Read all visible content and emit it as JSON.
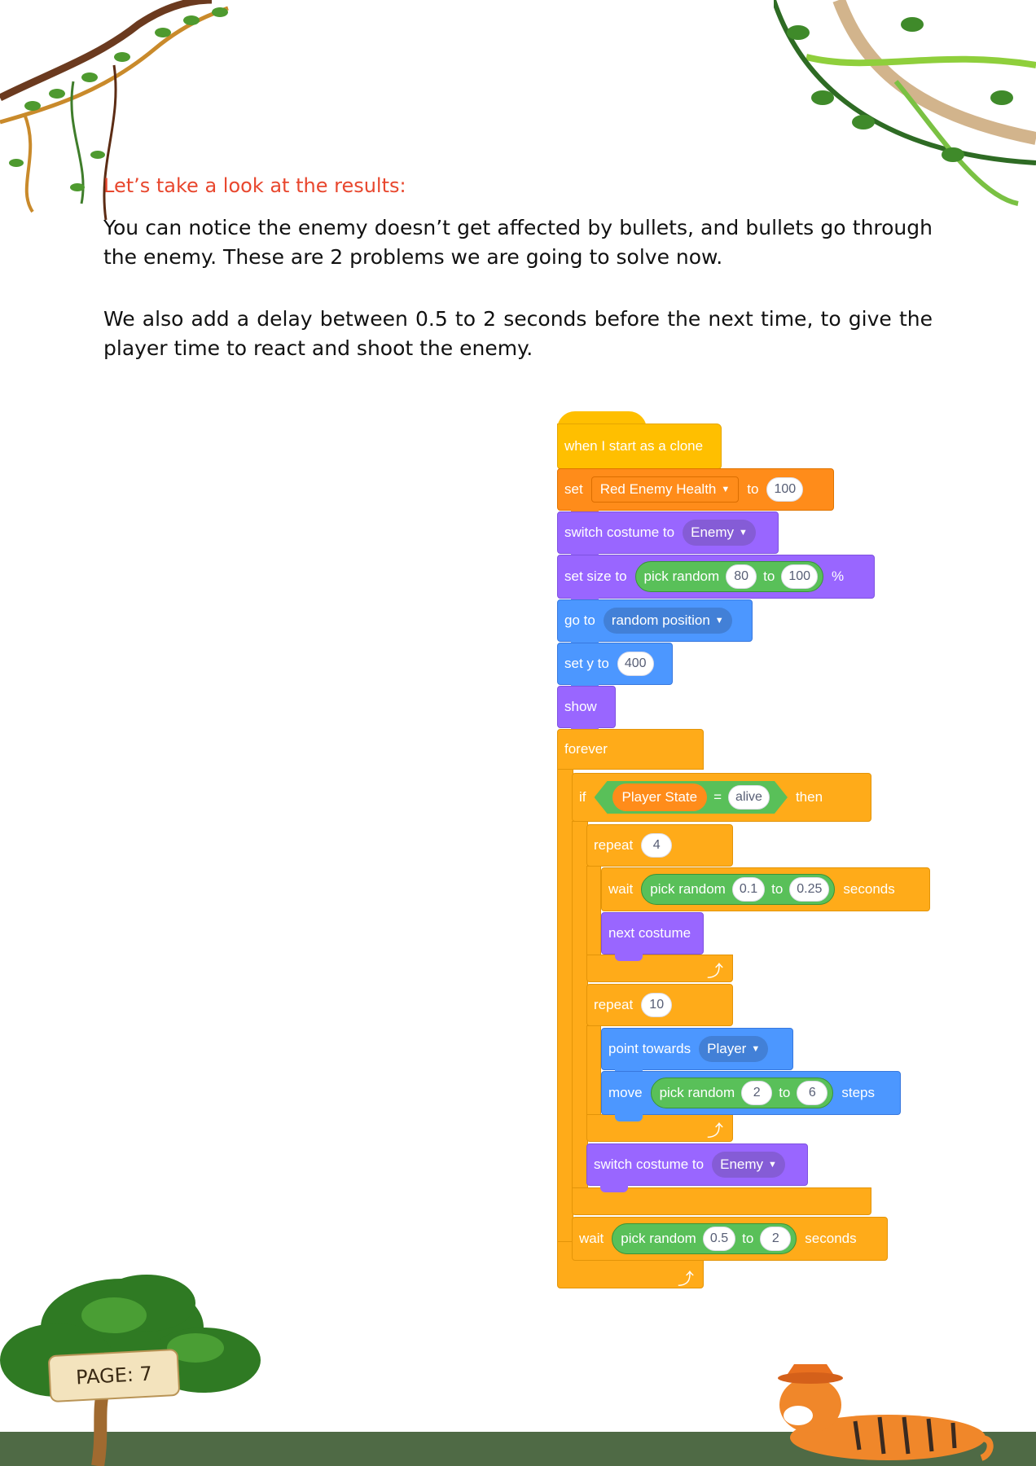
{
  "content": {
    "heading": "Let’s take a look at the results:",
    "paragraph_1": "You can notice the enemy doesn’t get affected by bullets, and bullets go through the enemy. These are 2 problems we are going to solve now.",
    "paragraph_2": "We also add a delay between 0.5 to 2 seconds before the next time, to give the player time to react and shoot the enemy."
  },
  "footer": {
    "page_label": "PAGE: 7"
  },
  "script": {
    "hat": "when I start as a clone",
    "set_var": {
      "label": "set",
      "var": "Red Enemy Health",
      "to": "to",
      "value": "100"
    },
    "costume1": {
      "label": "switch costume to",
      "value": "Enemy"
    },
    "set_size": {
      "label": "set size to",
      "op": "pick random",
      "a": "80",
      "to": "to",
      "b": "100",
      "unit": "%"
    },
    "go_to": {
      "label": "go to",
      "value": "random position"
    },
    "set_y": {
      "label": "set y to",
      "value": "400"
    },
    "show": "show",
    "forever": "forever",
    "if_block": {
      "label": "if",
      "var": "Player State",
      "eq": "=",
      "value": "alive",
      "then": "then"
    },
    "repeat1": {
      "label": "repeat",
      "value": "4"
    },
    "wait1": {
      "label": "wait",
      "op": "pick random",
      "a": "0.1",
      "to": "to",
      "b": "0.25",
      "unit": "seconds"
    },
    "next_costume": "next costume",
    "repeat2": {
      "label": "repeat",
      "value": "10"
    },
    "point": {
      "label": "point towards",
      "value": "Player"
    },
    "move": {
      "label": "move",
      "op": "pick random",
      "a": "2",
      "to": "to",
      "b": "6",
      "unit": "steps"
    },
    "costume2": {
      "label": "switch costume to",
      "value": "Enemy"
    },
    "wait2": {
      "label": "wait",
      "op": "pick random",
      "a": "0.5",
      "to": "to",
      "b": "2",
      "unit": "seconds"
    },
    "repeat_arrow": "⤴"
  },
  "colors": {
    "heading": "#e8472e",
    "events": "#ffbf00",
    "control": "#ffab19",
    "variables": "#ff8c1a",
    "looks": "#9966ff",
    "motion": "#4c97ff",
    "operators": "#59c059",
    "ground": "#4f6a45"
  }
}
